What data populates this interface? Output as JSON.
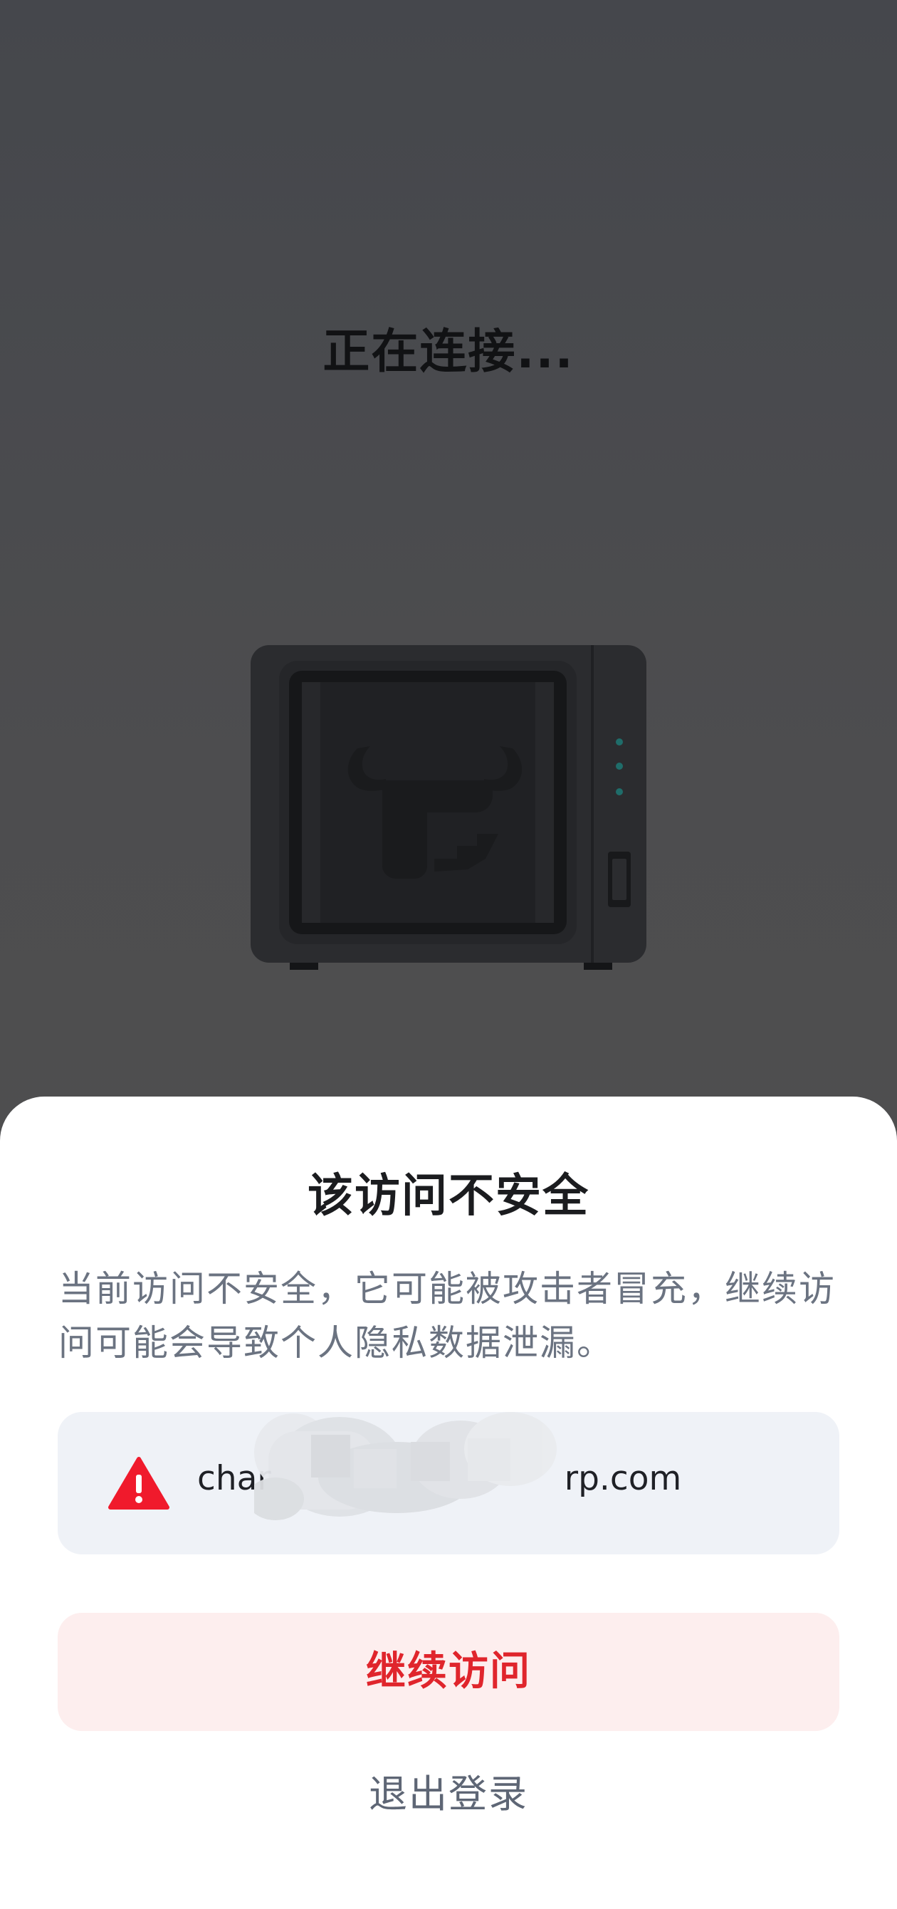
{
  "background": {
    "status_text": "正在连接..."
  },
  "device": {
    "icon": "nas-device-icon",
    "logo": "bull-logo-icon"
  },
  "dialog": {
    "title": "该访问不安全",
    "description": "当前访问不安全，它可能被攻击者冒充，继续访问可能会导致个人隐私数据泄漏。",
    "warning_icon": "warning-triangle-icon",
    "url_prefix": "char",
    "url_suffix": "rp.com",
    "continue_label": "继续访问",
    "logout_label": "退出登录"
  },
  "colors": {
    "accent_red": "#e0252c",
    "button_bg": "#fdeeee",
    "url_box_bg": "#eff2f7",
    "warning_red": "#f01a2c"
  }
}
